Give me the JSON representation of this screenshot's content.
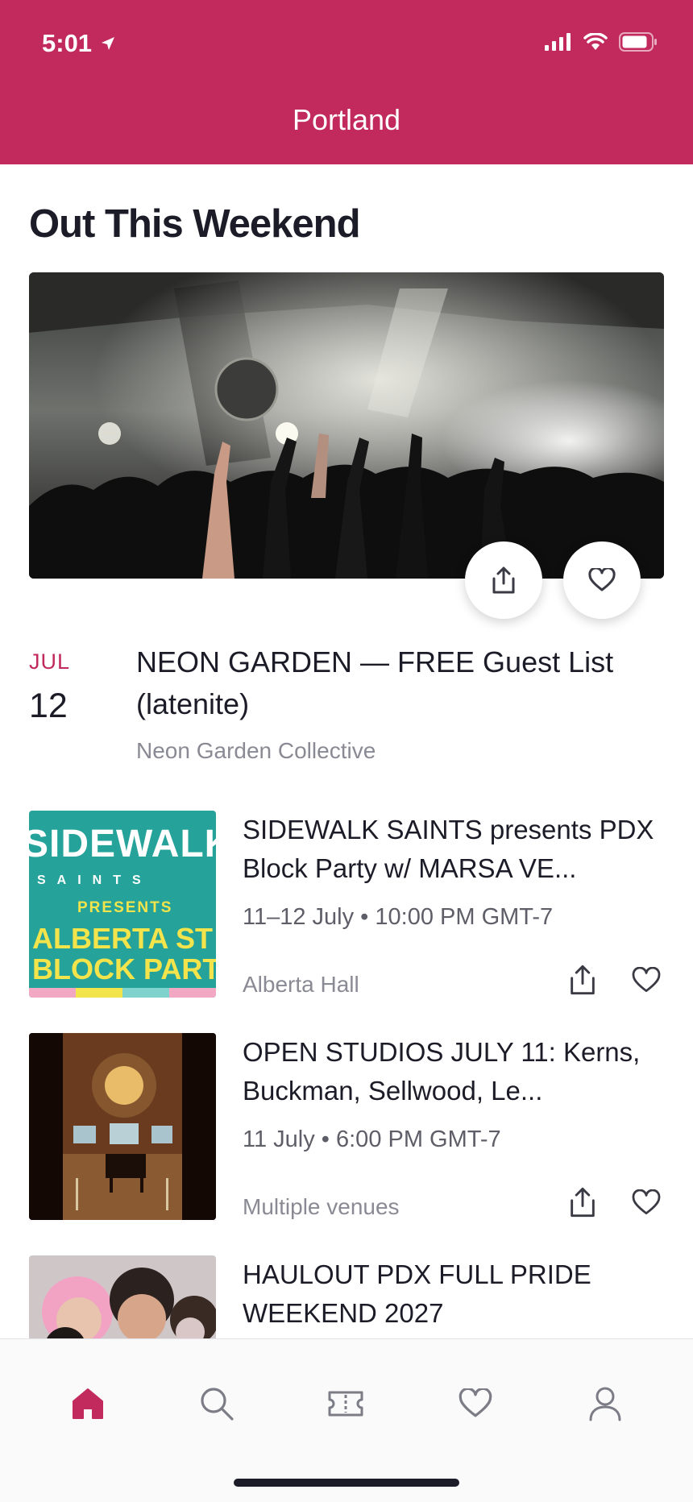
{
  "status_bar": {
    "time": "5:01"
  },
  "header": {
    "title": "Portland"
  },
  "section": {
    "title": "Out This Weekend"
  },
  "featured": {
    "month": "JUL",
    "day": "12",
    "title": "NEON GARDEN — FREE Guest List (latenite)",
    "organizer": "Neon Garden Collective"
  },
  "events": [
    {
      "title": "SIDEWALK SAINTS presents PDX Block Party w/ MARSA VE...",
      "when": "11–12 July • 10:00 PM GMT-7",
      "venue": "Alberta Hall",
      "poster": {
        "line1": "SIDEWALK",
        "line2": "SAINTS",
        "line3": "PRESENTS",
        "line4": "ALBERTA ST",
        "line5": "BLOCK PART"
      }
    },
    {
      "title": "OPEN STUDIOS JULY 11: Kerns, Buckman, Sellwood, Le...",
      "when": "11 July • 6:00 PM GMT-7",
      "venue": "Multiple venues"
    },
    {
      "title": "HAULOUT PDX FULL PRIDE WEEKEND 2027"
    }
  ],
  "tabbar": {
    "active": "home",
    "tabs": [
      "home",
      "search",
      "tickets",
      "favorites",
      "profile"
    ]
  },
  "colors": {
    "brand": "#c2295d",
    "text": "#1c1c28",
    "muted": "#8a8a94"
  }
}
